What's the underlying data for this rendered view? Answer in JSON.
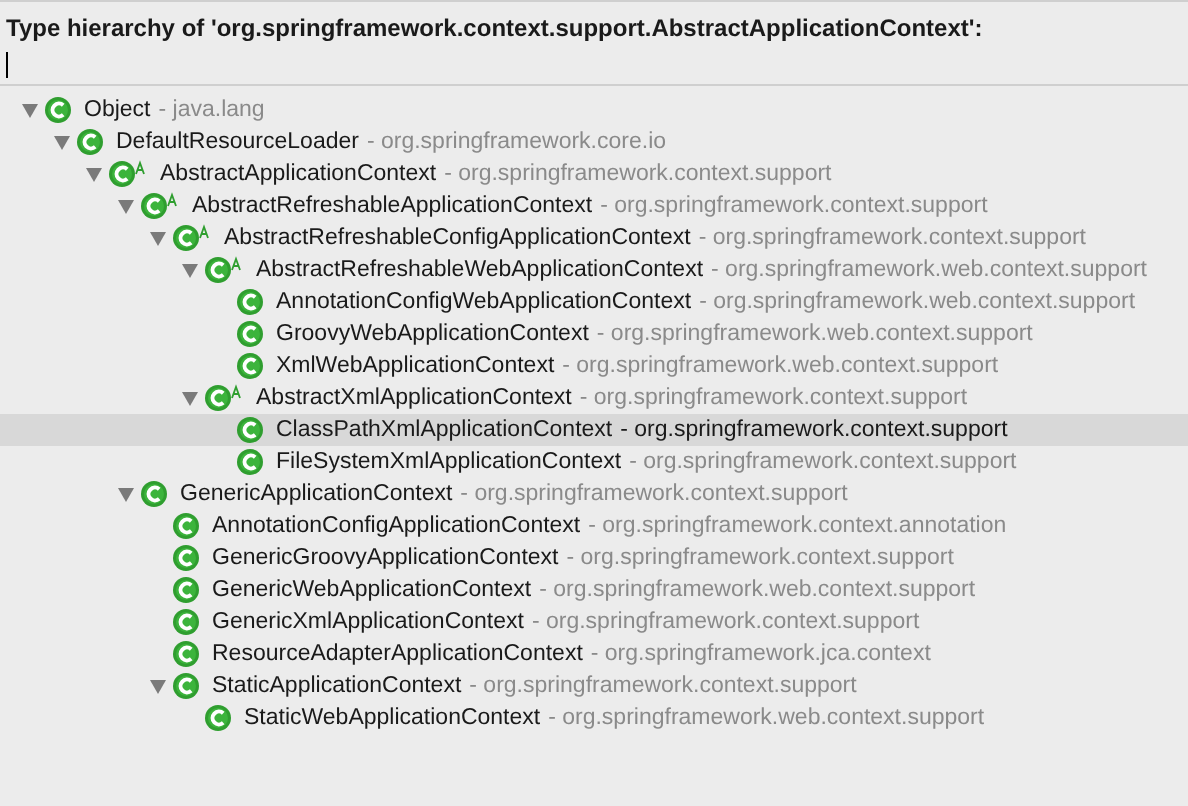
{
  "title": "Type hierarchy of 'org.springframework.context.support.AbstractApplicationContext':",
  "tree": [
    {
      "name": "Object",
      "package": "- java.lang",
      "abstract": false,
      "expanded": true,
      "selected": false,
      "children": [
        {
          "name": "DefaultResourceLoader",
          "package": "- org.springframework.core.io",
          "abstract": false,
          "expanded": true,
          "selected": false,
          "children": [
            {
              "name": "AbstractApplicationContext",
              "package": "- org.springframework.context.support",
              "abstract": true,
              "expanded": true,
              "selected": false,
              "children": [
                {
                  "name": "AbstractRefreshableApplicationContext",
                  "package": "- org.springframework.context.support",
                  "abstract": true,
                  "expanded": true,
                  "selected": false,
                  "children": [
                    {
                      "name": "AbstractRefreshableConfigApplicationContext",
                      "package": "- org.springframework.context.support",
                      "abstract": true,
                      "expanded": true,
                      "selected": false,
                      "children": [
                        {
                          "name": "AbstractRefreshableWebApplicationContext",
                          "package": "- org.springframework.web.context.support",
                          "abstract": true,
                          "expanded": true,
                          "selected": false,
                          "children": [
                            {
                              "name": "AnnotationConfigWebApplicationContext",
                              "package": "- org.springframework.web.context.support",
                              "abstract": false,
                              "selected": false
                            },
                            {
                              "name": "GroovyWebApplicationContext",
                              "package": "- org.springframework.web.context.support",
                              "abstract": false,
                              "selected": false
                            },
                            {
                              "name": "XmlWebApplicationContext",
                              "package": "- org.springframework.web.context.support",
                              "abstract": false,
                              "selected": false
                            }
                          ]
                        },
                        {
                          "name": "AbstractXmlApplicationContext",
                          "package": "- org.springframework.context.support",
                          "abstract": true,
                          "expanded": true,
                          "selected": false,
                          "children": [
                            {
                              "name": "ClassPathXmlApplicationContext",
                              "package": "- org.springframework.context.support",
                              "abstract": false,
                              "selected": true
                            },
                            {
                              "name": "FileSystemXmlApplicationContext",
                              "package": "- org.springframework.context.support",
                              "abstract": false,
                              "selected": false
                            }
                          ]
                        }
                      ]
                    }
                  ]
                },
                {
                  "name": "GenericApplicationContext",
                  "package": "- org.springframework.context.support",
                  "abstract": false,
                  "expanded": true,
                  "selected": false,
                  "children": [
                    {
                      "name": "AnnotationConfigApplicationContext",
                      "package": "- org.springframework.context.annotation",
                      "abstract": false,
                      "selected": false
                    },
                    {
                      "name": "GenericGroovyApplicationContext",
                      "package": "- org.springframework.context.support",
                      "abstract": false,
                      "selected": false
                    },
                    {
                      "name": "GenericWebApplicationContext",
                      "package": "- org.springframework.web.context.support",
                      "abstract": false,
                      "selected": false
                    },
                    {
                      "name": "GenericXmlApplicationContext",
                      "package": "- org.springframework.context.support",
                      "abstract": false,
                      "selected": false
                    },
                    {
                      "name": "ResourceAdapterApplicationContext",
                      "package": "- org.springframework.jca.context",
                      "abstract": false,
                      "selected": false
                    },
                    {
                      "name": "StaticApplicationContext",
                      "package": "- org.springframework.context.support",
                      "abstract": false,
                      "expanded": true,
                      "selected": false,
                      "children": [
                        {
                          "name": "StaticWebApplicationContext",
                          "package": "- org.springframework.web.context.support",
                          "abstract": false,
                          "selected": false
                        }
                      ]
                    }
                  ]
                }
              ]
            }
          ]
        }
      ]
    }
  ]
}
